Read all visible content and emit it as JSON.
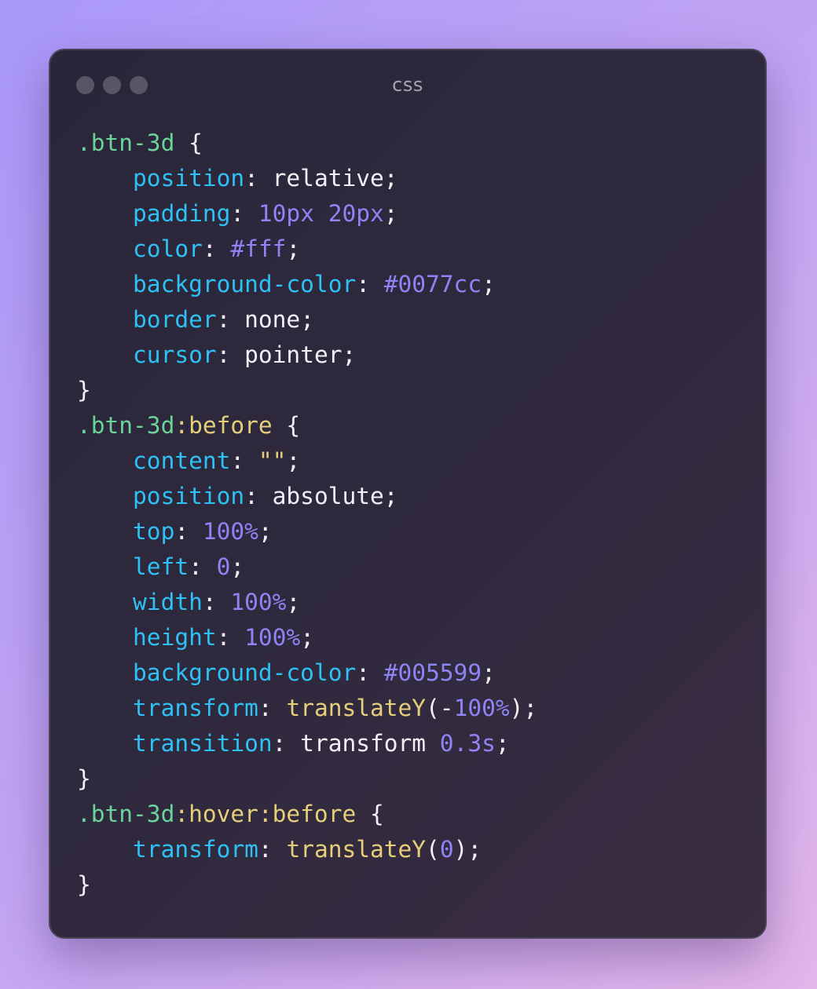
{
  "window": {
    "title": "css",
    "controls": [
      "dot-1",
      "dot-2",
      "dot-3"
    ]
  },
  "colors": {
    "selector": "#6ad59a",
    "pseudo": "#e6cf7a",
    "property": "#2ec1f5",
    "number": "#8f84f5",
    "function": "#e6cf7a",
    "plain": "#f2f0f6"
  },
  "code_lines": [
    [
      {
        "t": ".btn-3d",
        "k": "sel"
      },
      {
        "t": " {",
        "k": "plain"
      }
    ],
    [
      {
        "t": "    ",
        "k": "plain"
      },
      {
        "t": "position",
        "k": "prop"
      },
      {
        "t": ": relative;",
        "k": "plain"
      }
    ],
    [
      {
        "t": "    ",
        "k": "plain"
      },
      {
        "t": "padding",
        "k": "prop"
      },
      {
        "t": ": ",
        "k": "plain"
      },
      {
        "t": "10px",
        "k": "num"
      },
      {
        "t": " ",
        "k": "plain"
      },
      {
        "t": "20px",
        "k": "num"
      },
      {
        "t": ";",
        "k": "plain"
      }
    ],
    [
      {
        "t": "    ",
        "k": "plain"
      },
      {
        "t": "color",
        "k": "prop"
      },
      {
        "t": ": ",
        "k": "plain"
      },
      {
        "t": "#fff",
        "k": "num"
      },
      {
        "t": ";",
        "k": "plain"
      }
    ],
    [
      {
        "t": "    ",
        "k": "plain"
      },
      {
        "t": "background-color",
        "k": "prop"
      },
      {
        "t": ": ",
        "k": "plain"
      },
      {
        "t": "#0077cc",
        "k": "num"
      },
      {
        "t": ";",
        "k": "plain"
      }
    ],
    [
      {
        "t": "    ",
        "k": "plain"
      },
      {
        "t": "border",
        "k": "prop"
      },
      {
        "t": ": none;",
        "k": "plain"
      }
    ],
    [
      {
        "t": "    ",
        "k": "plain"
      },
      {
        "t": "cursor",
        "k": "prop"
      },
      {
        "t": ": pointer;",
        "k": "plain"
      }
    ],
    [
      {
        "t": "}",
        "k": "plain"
      }
    ],
    [
      {
        "t": ".btn-3d",
        "k": "sel"
      },
      {
        "t": ":before",
        "k": "pseudo"
      },
      {
        "t": " {",
        "k": "plain"
      }
    ],
    [
      {
        "t": "    ",
        "k": "plain"
      },
      {
        "t": "content",
        "k": "prop"
      },
      {
        "t": ": ",
        "k": "plain"
      },
      {
        "t": "\"\"",
        "k": "str"
      },
      {
        "t": ";",
        "k": "plain"
      }
    ],
    [
      {
        "t": "    ",
        "k": "plain"
      },
      {
        "t": "position",
        "k": "prop"
      },
      {
        "t": ": absolute;",
        "k": "plain"
      }
    ],
    [
      {
        "t": "    ",
        "k": "plain"
      },
      {
        "t": "top",
        "k": "prop"
      },
      {
        "t": ": ",
        "k": "plain"
      },
      {
        "t": "100%",
        "k": "num"
      },
      {
        "t": ";",
        "k": "plain"
      }
    ],
    [
      {
        "t": "    ",
        "k": "plain"
      },
      {
        "t": "left",
        "k": "prop"
      },
      {
        "t": ": ",
        "k": "plain"
      },
      {
        "t": "0",
        "k": "num"
      },
      {
        "t": ";",
        "k": "plain"
      }
    ],
    [
      {
        "t": "    ",
        "k": "plain"
      },
      {
        "t": "width",
        "k": "prop"
      },
      {
        "t": ": ",
        "k": "plain"
      },
      {
        "t": "100%",
        "k": "num"
      },
      {
        "t": ";",
        "k": "plain"
      }
    ],
    [
      {
        "t": "    ",
        "k": "plain"
      },
      {
        "t": "height",
        "k": "prop"
      },
      {
        "t": ": ",
        "k": "plain"
      },
      {
        "t": "100%",
        "k": "num"
      },
      {
        "t": ";",
        "k": "plain"
      }
    ],
    [
      {
        "t": "    ",
        "k": "plain"
      },
      {
        "t": "background-color",
        "k": "prop"
      },
      {
        "t": ": ",
        "k": "plain"
      },
      {
        "t": "#005599",
        "k": "num"
      },
      {
        "t": ";",
        "k": "plain"
      }
    ],
    [
      {
        "t": "    ",
        "k": "plain"
      },
      {
        "t": "transform",
        "k": "prop"
      },
      {
        "t": ": ",
        "k": "plain"
      },
      {
        "t": "translateY",
        "k": "fn"
      },
      {
        "t": "(-",
        "k": "plain"
      },
      {
        "t": "100%",
        "k": "num"
      },
      {
        "t": ");",
        "k": "plain"
      }
    ],
    [
      {
        "t": "    ",
        "k": "plain"
      },
      {
        "t": "transition",
        "k": "prop"
      },
      {
        "t": ": transform ",
        "k": "plain"
      },
      {
        "t": "0.3s",
        "k": "num"
      },
      {
        "t": ";",
        "k": "plain"
      }
    ],
    [
      {
        "t": "}",
        "k": "plain"
      }
    ],
    [
      {
        "t": ".btn-3d",
        "k": "sel"
      },
      {
        "t": ":hover:before",
        "k": "pseudo"
      },
      {
        "t": " {",
        "k": "plain"
      }
    ],
    [
      {
        "t": "    ",
        "k": "plain"
      },
      {
        "t": "transform",
        "k": "prop"
      },
      {
        "t": ": ",
        "k": "plain"
      },
      {
        "t": "translateY",
        "k": "fn"
      },
      {
        "t": "(",
        "k": "plain"
      },
      {
        "t": "0",
        "k": "num"
      },
      {
        "t": ");",
        "k": "plain"
      }
    ],
    [
      {
        "t": "}",
        "k": "plain"
      }
    ]
  ]
}
